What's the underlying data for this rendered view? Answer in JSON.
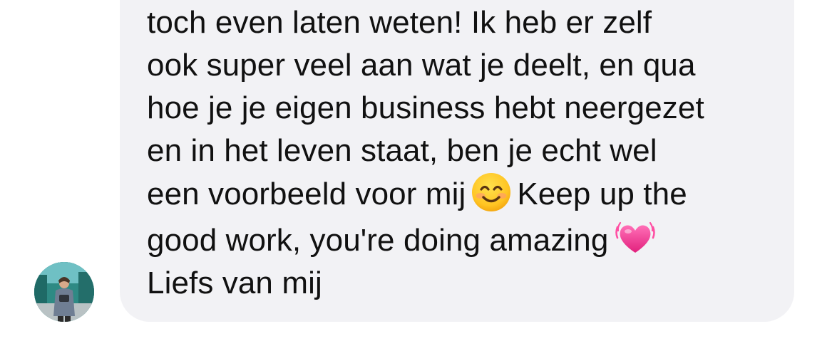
{
  "message": {
    "lines": [
      {
        "text": "toch even laten weten! Ik heb er zelf"
      },
      {
        "text": "ook super veel aan wat je deelt, en qua"
      },
      {
        "text": "hoe je je eigen business hebt neergezet"
      },
      {
        "text": "en in het leven staat, ben je echt wel"
      },
      {
        "before": "een voorbeeld voor mij",
        "emoji": "smiling-face-emoji",
        "after": "Keep up the"
      },
      {
        "before": "good work, you're doing amazing",
        "emoji": "beating-heart-emoji"
      },
      {
        "text": "Liefs van mij"
      }
    ]
  },
  "avatar": {
    "icon": "profile-photo"
  },
  "colors": {
    "bubble": "#f2f2f5",
    "text": "#111111",
    "background": "#ffffff"
  }
}
